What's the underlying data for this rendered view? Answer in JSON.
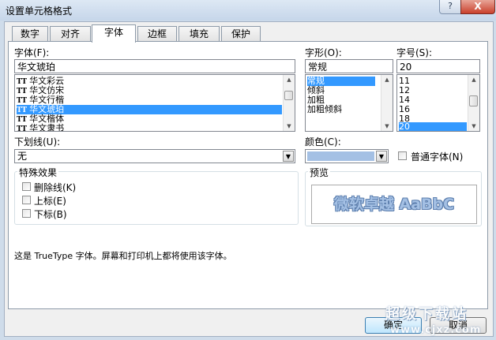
{
  "window": {
    "title": "设置单元格格式",
    "help_label": "?",
    "close_label": "X"
  },
  "tabs": [
    {
      "label": "数字",
      "active": false
    },
    {
      "label": "对齐",
      "active": false
    },
    {
      "label": "字体",
      "active": true
    },
    {
      "label": "边框",
      "active": false
    },
    {
      "label": "填充",
      "active": false
    },
    {
      "label": "保护",
      "active": false
    }
  ],
  "font": {
    "label": "字体(F):",
    "value": "华文琥珀",
    "list": [
      "华文彩云",
      "华文仿宋",
      "华文行楷",
      "华文琥珀",
      "华文楷体",
      "华文隶书"
    ],
    "selected": 3
  },
  "style": {
    "label": "字形(O):",
    "value": "常规",
    "list": [
      "常规",
      "倾斜",
      "加粗",
      "加粗倾斜"
    ],
    "selected": 0
  },
  "size": {
    "label": "字号(S):",
    "value": "20",
    "list": [
      "11",
      "12",
      "14",
      "16",
      "18",
      "20"
    ],
    "selected": 5
  },
  "underline": {
    "label": "下划线(U):",
    "value": "无"
  },
  "color": {
    "label": "颜色(C):",
    "swatch": "#a4c0e4"
  },
  "normal_font": {
    "label": "普通字体(N)",
    "checked": false
  },
  "effects": {
    "label": "特殊效果",
    "items": [
      {
        "label": "删除线(K)",
        "checked": false
      },
      {
        "label": "上标(E)",
        "checked": false
      },
      {
        "label": "下标(B)",
        "checked": false
      }
    ]
  },
  "preview": {
    "label": "预览",
    "text": "微软卓越 AaBbC",
    "color": "#a4c0e4"
  },
  "note": "这是 TrueType 字体。屏幕和打印机上都将使用该字体。",
  "buttons": {
    "ok": "确定",
    "cancel": "取消"
  },
  "watermark": {
    "line1": "超级下载站",
    "line2": "www.cjxz.com"
  },
  "colors": {
    "accent": "#3399ff",
    "titlebar": "#cfdcea",
    "close": "#c9402c"
  }
}
